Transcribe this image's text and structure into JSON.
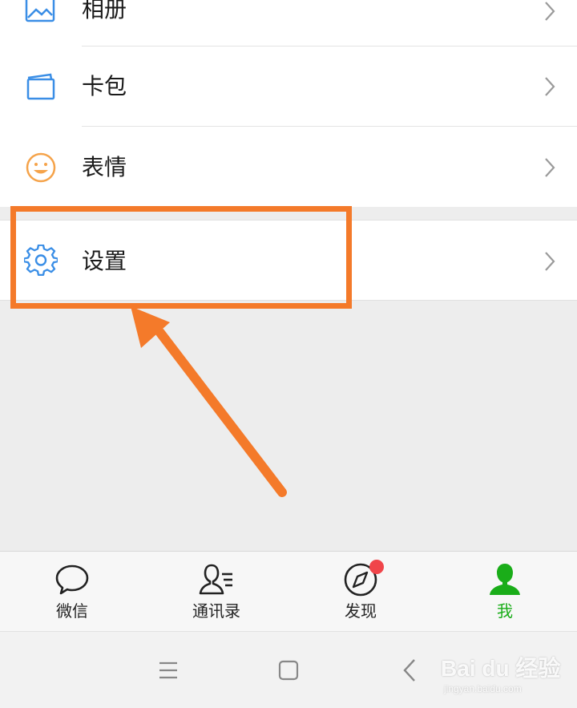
{
  "menu": {
    "items": [
      {
        "label": "相册",
        "icon": "photo-album-icon"
      },
      {
        "label": "卡包",
        "icon": "card-wallet-icon"
      },
      {
        "label": "表情",
        "icon": "emoji-smile-icon"
      },
      {
        "label": "设置",
        "icon": "gear-icon"
      }
    ]
  },
  "tabs": [
    {
      "label": "微信",
      "icon": "chat-bubble-icon",
      "active": false
    },
    {
      "label": "通讯录",
      "icon": "contacts-icon",
      "active": false
    },
    {
      "label": "发现",
      "icon": "compass-icon",
      "active": false,
      "badge": "red-dot"
    },
    {
      "label": "我",
      "icon": "person-icon",
      "active": true
    }
  ],
  "system_nav": [
    "menu-icon",
    "home-square-icon",
    "back-chevron-icon"
  ],
  "watermark": {
    "logo": "Bai du 经验",
    "url": "jingyan.baidu.com"
  },
  "colors": {
    "accent_green": "#1aad19",
    "annotation_orange": "#f47a2a",
    "icon_blue": "#3a8ee6",
    "icon_orange": "#f5a34a",
    "badge_red": "#f0454a"
  }
}
